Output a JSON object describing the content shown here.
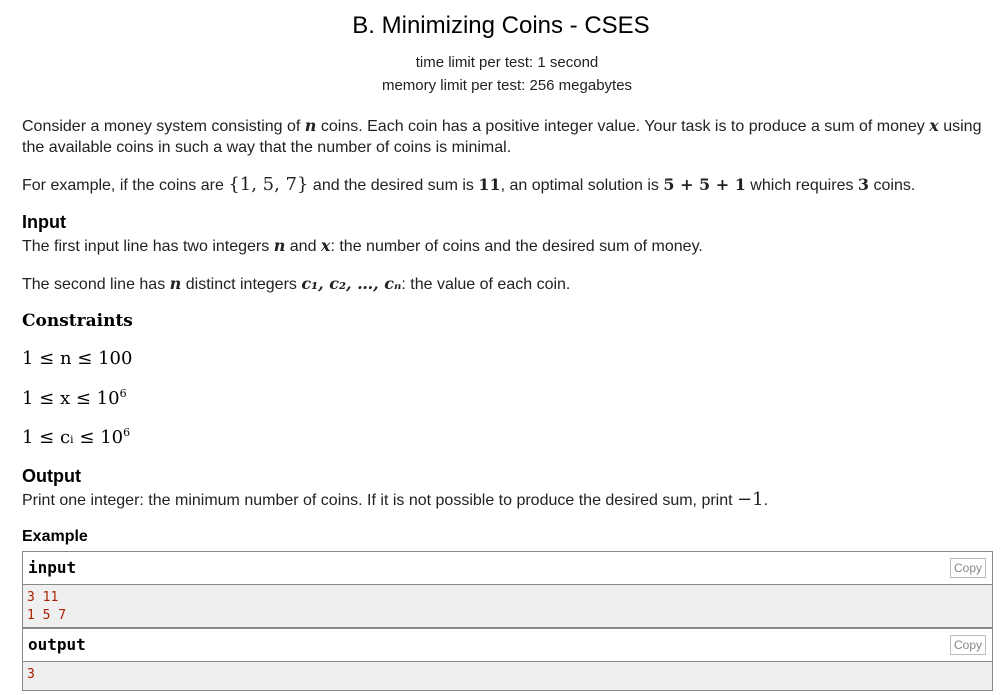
{
  "problem": {
    "title": "B. Minimizing Coins - CSES",
    "time_limit": "time limit per test: 1 second",
    "memory_limit": "memory limit per test: 256 megabytes"
  },
  "statement": {
    "p1_a": "Consider a money system consisting of ",
    "p1_n": "n",
    "p1_b": " coins. Each coin has a positive integer value. Your task is to produce a sum of money ",
    "p1_x": "x",
    "p1_c": " using the available coins in such a way that the number of coins is minimal.",
    "p2_a": "For example, if the coins are ",
    "p2_set": "{1, 5, 7}",
    "p2_b": " and the desired sum is ",
    "p2_sum": "11",
    "p2_c": ", an optimal solution is ",
    "p2_sol": "5 + 5 + 1",
    "p2_d": " which requires ",
    "p2_cnt": "3",
    "p2_e": " coins."
  },
  "input": {
    "heading": "Input",
    "l1_a": "The first input line has two integers ",
    "l1_n": "n",
    "l1_b": " and ",
    "l1_x": "x",
    "l1_c": ": the number of coins and the desired sum of money.",
    "l2_a": "The second line has ",
    "l2_n": "n",
    "l2_b": " distinct integers ",
    "l2_c": "c₁, c₂, …, cₙ",
    "l2_d": ": the value of each coin."
  },
  "constraints": {
    "heading": "Constraints",
    "c1": "1 ≤ n ≤ 100",
    "c2_base": "1 ≤ x ≤ 10",
    "c2_exp": "6",
    "c3_base": "1 ≤ cᵢ ≤ 10",
    "c3_exp": "6"
  },
  "output": {
    "heading": "Output",
    "text_a": "Print one integer: the minimum number of coins. If it is not possible to produce the desired sum, print ",
    "text_val": "−1",
    "text_b": "."
  },
  "example": {
    "heading": "Example",
    "input_label": "input",
    "input_copy": "Copy",
    "input_lines": "3 11\n1 5 7",
    "output_label": "output",
    "output_copy": "Copy",
    "output_lines": "3"
  }
}
